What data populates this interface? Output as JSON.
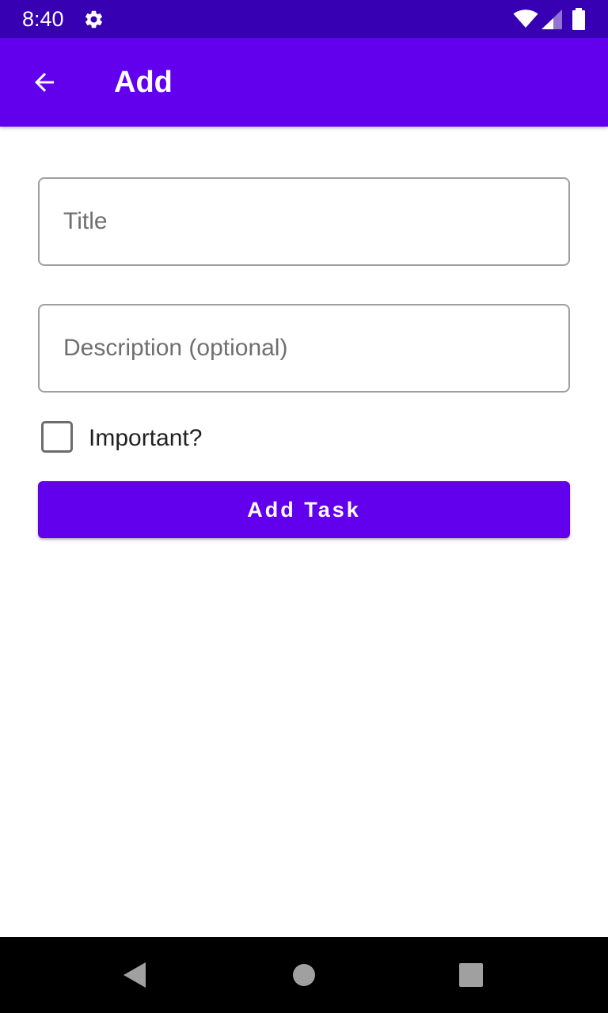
{
  "status_bar": {
    "time": "8:40",
    "icons": [
      "gear-icon",
      "wifi-icon",
      "cell-signal-icon",
      "battery-icon"
    ],
    "background": "#3700B3"
  },
  "app_bar": {
    "title": "Add",
    "back_icon": "arrow-back-icon",
    "background": "#6200EE"
  },
  "form": {
    "title_placeholder": "Title",
    "title_value": "",
    "description_placeholder": "Description (optional)",
    "description_value": "",
    "important_label": "Important?",
    "important_checked": false,
    "submit_label": "Add Task"
  },
  "nav_bar": {
    "icons": [
      "back-triangle-icon",
      "home-circle-icon",
      "recents-square-icon"
    ]
  },
  "colors": {
    "primary": "#6200EE",
    "primary_dark": "#3700B3",
    "outline": "#9e9e9e"
  }
}
